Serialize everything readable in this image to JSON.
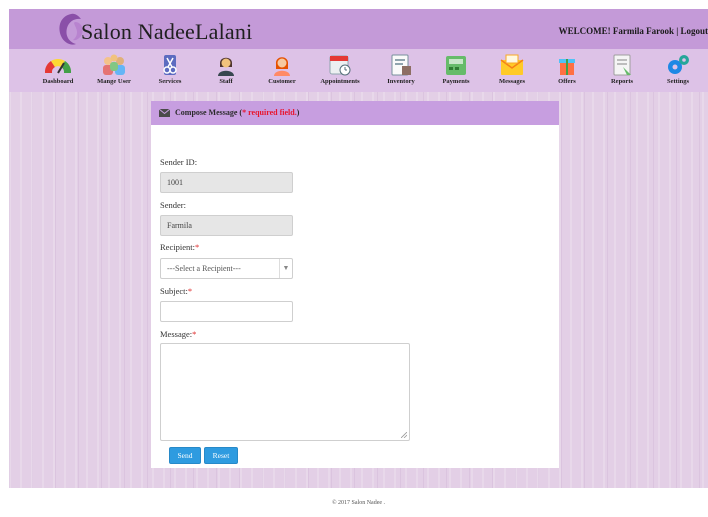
{
  "header": {
    "brand": "Salon NadeeLalani",
    "welcome": "WELCOME! Farmila Farook |",
    "logout": "Logout"
  },
  "nav": {
    "items": [
      {
        "label": "Dashboard",
        "icon": "gauge-icon"
      },
      {
        "label": "Mange User",
        "icon": "users-icon"
      },
      {
        "label": "Services",
        "icon": "scissors-icon"
      },
      {
        "label": "Staff",
        "icon": "staff-icon"
      },
      {
        "label": "Customer",
        "icon": "customer-icon"
      },
      {
        "label": "Appointments",
        "icon": "calendar-clock-icon"
      },
      {
        "label": "Inventory",
        "icon": "inventory-icon"
      },
      {
        "label": "Payments",
        "icon": "cash-register-icon"
      },
      {
        "label": "Messages",
        "icon": "envelope-icon"
      },
      {
        "label": "Offers",
        "icon": "gift-icon"
      },
      {
        "label": "Reports",
        "icon": "report-icon"
      },
      {
        "label": "Settings",
        "icon": "gears-icon"
      }
    ]
  },
  "compose": {
    "title": "Compose Message (",
    "required_note": "* required field.",
    "title_close": ")",
    "sender_id_label": "Sender ID:",
    "sender_id_value": "1001",
    "sender_label": "Sender:",
    "sender_value": "Farmila",
    "recipient_label": "Recipient:",
    "recipient_selected": "---Select a Recipient---",
    "subject_label": "Subject:",
    "subject_value": "",
    "message_label": "Message:",
    "message_value": "",
    "required_mark": "*",
    "send_label": "Send",
    "reset_label": "Reset"
  },
  "footer": {
    "text": "© 2017 Salon Nadee ."
  },
  "colors": {
    "header_bg": "#c49ad8",
    "nav_bg": "#ddc2e7",
    "page_bg": "#e3cfe6",
    "panel_head_bg": "#c79ee0",
    "button_bg": "#2e9be0",
    "required_red": "#e8162e"
  }
}
